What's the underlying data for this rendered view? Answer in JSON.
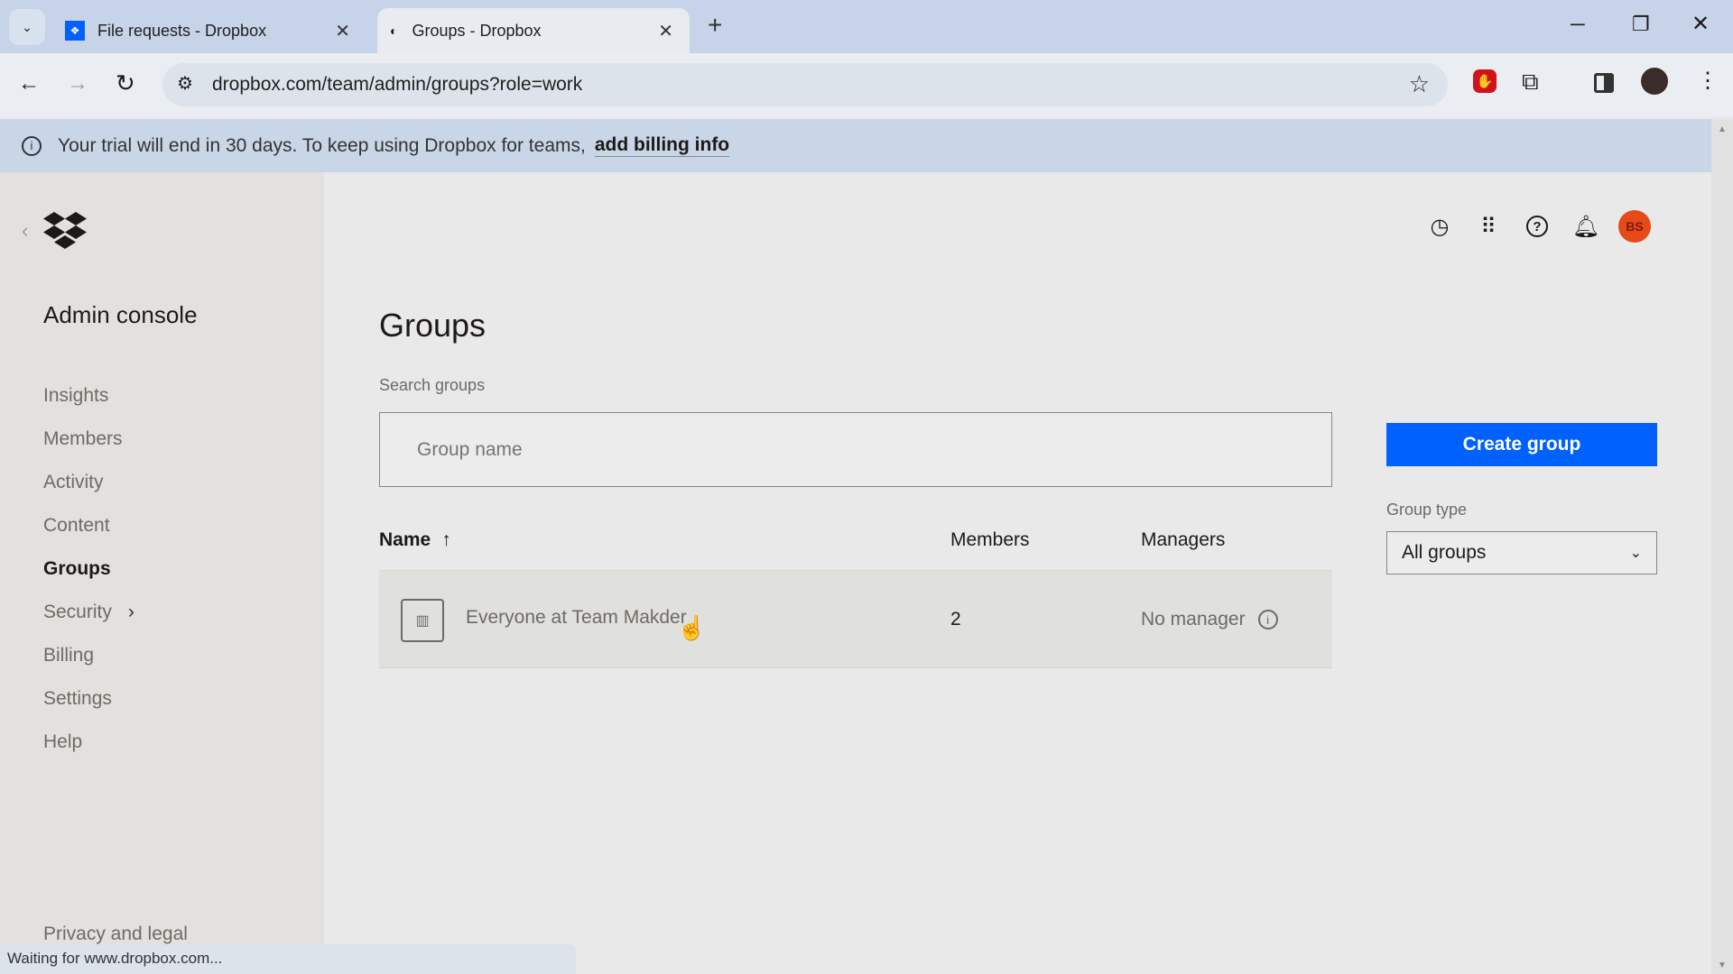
{
  "browser": {
    "tabs": [
      {
        "label": "File requests - Dropbox"
      },
      {
        "label": "Groups - Dropbox"
      }
    ],
    "url": "dropbox.com/team/admin/groups?role=work",
    "status": "Waiting for www.dropbox.com..."
  },
  "banner": {
    "text": "Your trial will end in 30 days. To keep using Dropbox for teams,",
    "link": "add billing info"
  },
  "sidebar": {
    "title": "Admin console",
    "items": [
      {
        "label": "Insights"
      },
      {
        "label": "Members"
      },
      {
        "label": "Activity"
      },
      {
        "label": "Content"
      },
      {
        "label": "Groups",
        "active": true
      },
      {
        "label": "Security"
      },
      {
        "label": "Billing"
      },
      {
        "label": "Settings"
      },
      {
        "label": "Help"
      }
    ],
    "footer": "Privacy and legal"
  },
  "header": {
    "avatar_initials": "BS",
    "avatar_color": "#e64a19"
  },
  "main": {
    "title": "Groups",
    "search_label": "Search groups",
    "search_placeholder": "Group name",
    "create_button": "Create group",
    "group_type_label": "Group type",
    "group_type_value": "All groups",
    "columns": {
      "name": "Name",
      "members": "Members",
      "managers": "Managers"
    },
    "rows": [
      {
        "name": "Everyone at Team Makder",
        "members": "2",
        "managers": "No manager"
      }
    ]
  },
  "colors": {
    "accent": "#0061fe"
  }
}
